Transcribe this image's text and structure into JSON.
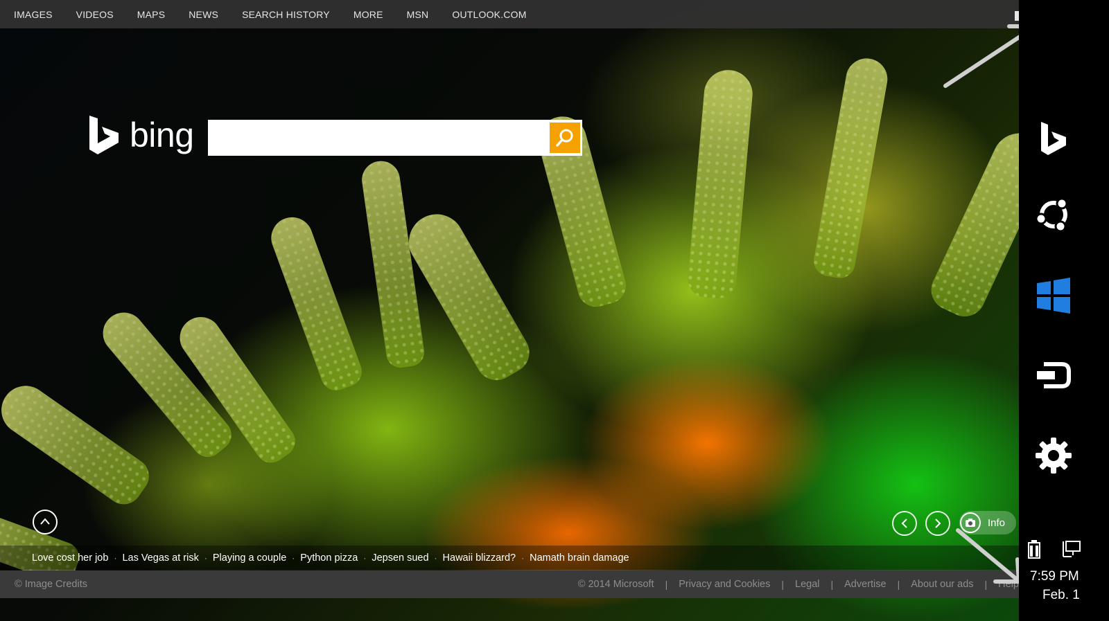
{
  "nav": {
    "items": [
      "IMAGES",
      "VIDEOS",
      "MAPS",
      "NEWS",
      "SEARCH HISTORY",
      "MORE",
      "MSN",
      "OUTLOOK.COM"
    ]
  },
  "logo": {
    "wordmark": "bing"
  },
  "search": {
    "value": "",
    "placeholder": "",
    "button_icon": "search-icon"
  },
  "controls": {
    "up_icon": "chevron-up-icon",
    "prev_icon": "chevron-left-icon",
    "next_icon": "chevron-right-icon",
    "info_label": "Info",
    "info_icon": "camera-icon"
  },
  "news": [
    "Love cost her job",
    "Las Vegas at risk",
    "Playing a couple",
    "Python pizza",
    "Jepsen sued",
    "Hawaii blizzard?",
    "Namath brain damage"
  ],
  "footer": {
    "credits": "© Image Credits",
    "links": [
      "© 2014 Microsoft",
      "Privacy and Cookies",
      "Legal",
      "Advertise",
      "About our ads",
      "Help"
    ]
  },
  "charms": {
    "items": [
      "bing-icon",
      "share-icon",
      "windows-start-icon",
      "devices-icon",
      "settings-icon"
    ],
    "status_icons": [
      "battery-icon",
      "network-icon"
    ]
  },
  "clock": {
    "time": "7:59 PM",
    "date": "Feb. 1"
  },
  "colors": {
    "search_button": "#f5a100",
    "nav_bg": "#323232",
    "footer_bg": "#3a3a3a"
  }
}
